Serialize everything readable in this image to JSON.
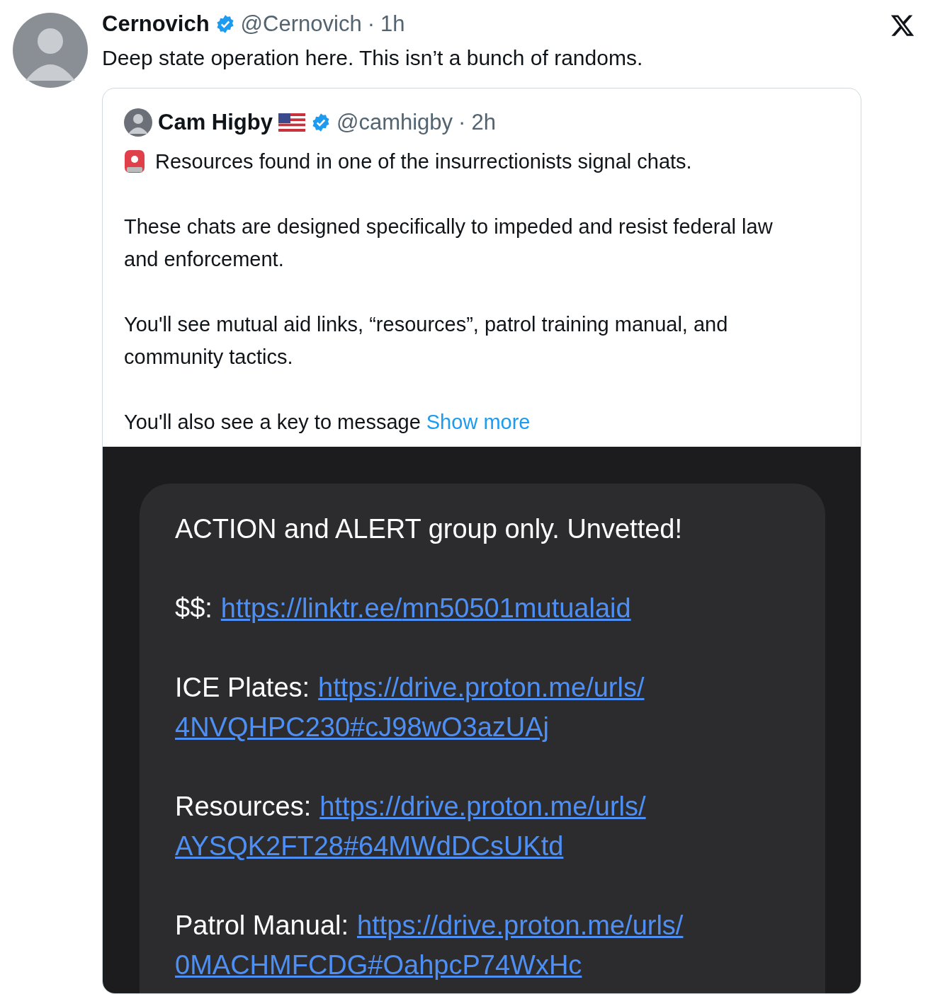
{
  "post": {
    "author": "Cernovich",
    "verified": true,
    "handle": "@Cernovich",
    "separator": "·",
    "time": "1h",
    "text": "Deep state operation here. This isn’t a bunch of randoms."
  },
  "quoted_post": {
    "author": "Cam Higby",
    "verified": true,
    "handle": "@camhigby",
    "separator": "·",
    "time": "2h",
    "paragraphs": [
      {
        "kind": "alert",
        "text": "Resources found in one of the insurrectionists signal chats."
      },
      {
        "kind": "plain",
        "text": "These chats are designed specifically to impeded and resist federal law and enforcement."
      },
      {
        "kind": "plain",
        "text": "You'll see mutual aid links, “resources”, patrol training manual, and community tactics."
      },
      {
        "kind": "plain",
        "text": "You'll also see a key to message"
      }
    ],
    "show_more": "Show more",
    "image": {
      "title": "ACTION and ALERT group only. Unvetted!",
      "entries": [
        {
          "label": "$$:",
          "link": "https://linktr.ee/mn50501mutualaid"
        },
        {
          "label": "ICE Plates:",
          "link": "https://drive.proton.me/urls/4NVQHPC230#cJ98wO3azUAj"
        },
        {
          "label": "Resources:",
          "link": "https://drive.proton.me/urls/AYSQK2FT28#64MWdDCsUKtd"
        },
        {
          "label": "Patrol Manual:",
          "link": "https://drive.proton.me/urls/0MACHMFCDG#OahpcP74WxHc"
        }
      ]
    }
  }
}
